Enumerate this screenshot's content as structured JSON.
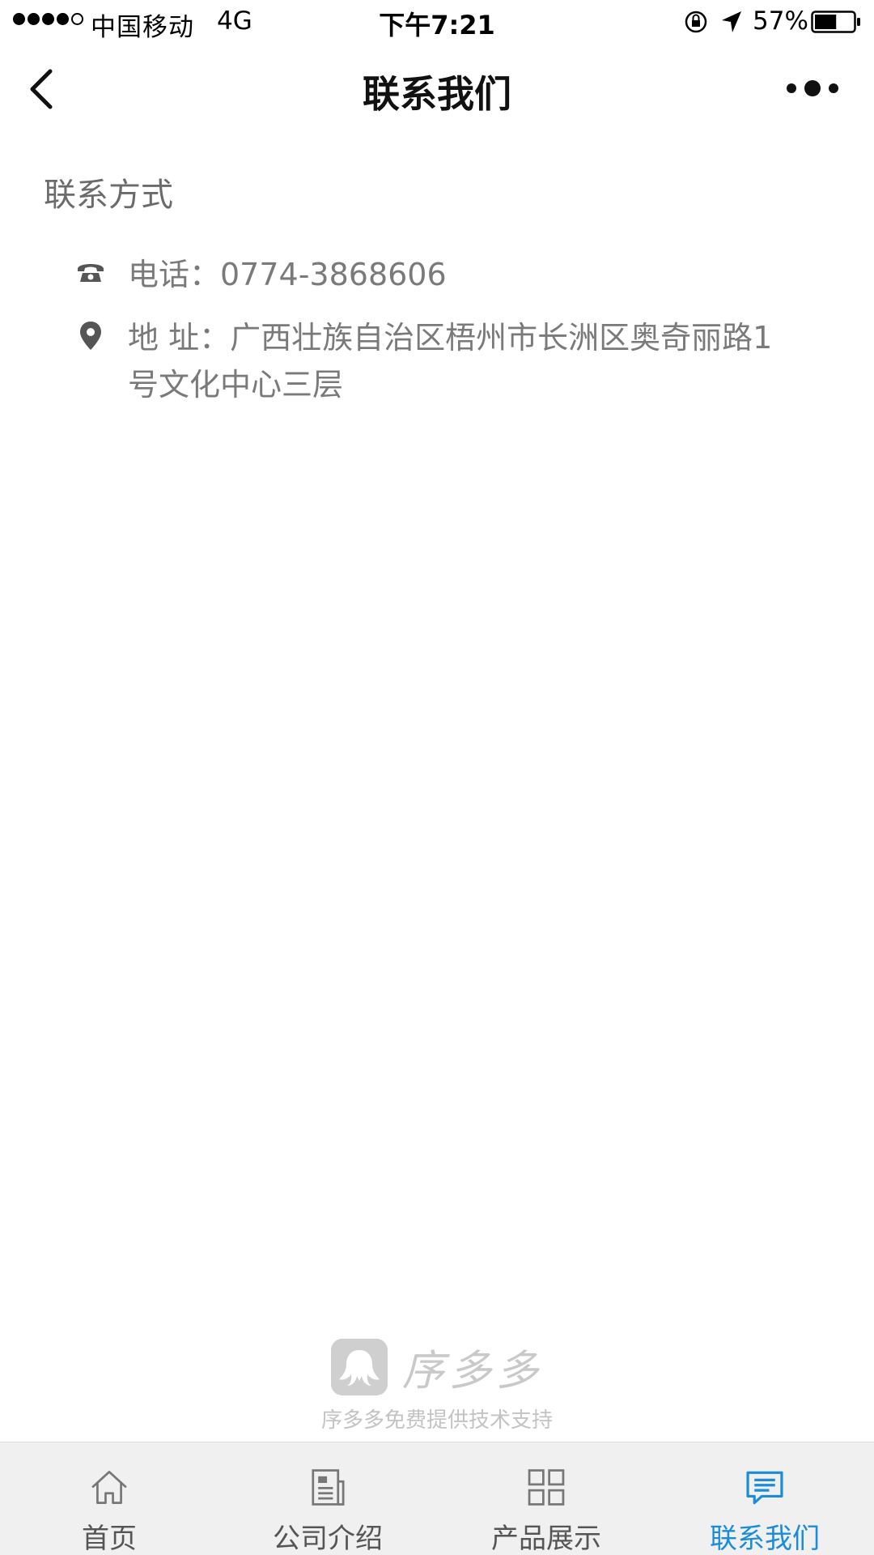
{
  "status_bar": {
    "carrier": "中国移动",
    "network": "4G",
    "time": "下午7:21",
    "battery_percent": "57%",
    "battery_level": 0.57
  },
  "nav": {
    "title": "联系我们",
    "back_icon": "chevron-left-icon",
    "more_icon": "more-dots-icon"
  },
  "content": {
    "section_title": "联系方式",
    "phone": {
      "icon": "phone-icon",
      "text": "电话：0774-3868606"
    },
    "address": {
      "icon": "location-pin-icon",
      "text": "地 址：广西壮族自治区梧州市长洲区奥奇丽路1号文化中心三层"
    }
  },
  "branding": {
    "name": "序多多",
    "support_text": "序多多免费提供技术支持"
  },
  "tab_bar": {
    "active_color": "#1a8cd8",
    "tabs": [
      {
        "label": "首页",
        "icon": "home-icon"
      },
      {
        "label": "公司介绍",
        "icon": "document-icon"
      },
      {
        "label": "产品展示",
        "icon": "grid-icon"
      },
      {
        "label": "联系我们",
        "icon": "chat-icon",
        "active": true
      }
    ]
  }
}
